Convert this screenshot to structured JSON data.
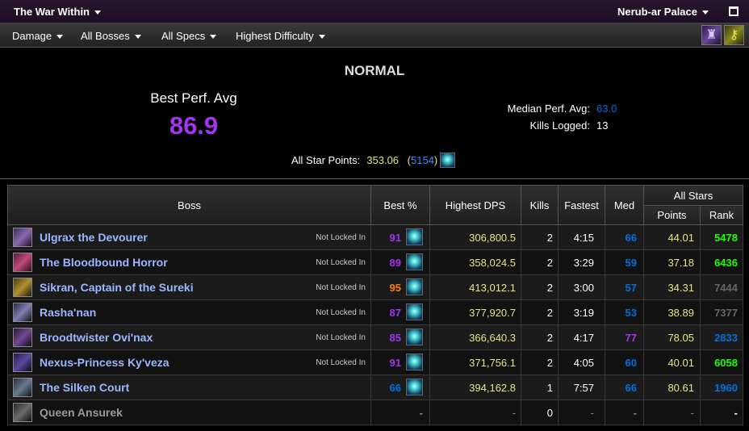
{
  "topbar": {
    "expansion": "The War Within",
    "raid": "Nerub-ar Palace"
  },
  "filters": {
    "metric": "Damage",
    "bosses": "All Bosses",
    "specs": "All Specs",
    "difficulty": "Highest Difficulty"
  },
  "summary": {
    "difficulty": "NORMAL",
    "best_perf_label": "Best Perf. Avg",
    "best_perf_value": "86.9",
    "median_label": "Median Perf. Avg:",
    "median_value": "63.0",
    "kills_label": "Kills Logged:",
    "kills_value": "13",
    "star_points_label": "All Star Points:",
    "star_points_value": "353.06",
    "star_points_rank": "5154"
  },
  "table": {
    "headers": {
      "boss": "Boss",
      "best": "Best %",
      "dps": "Highest DPS",
      "kills": "Kills",
      "fastest": "Fastest",
      "med": "Med",
      "all_stars": "All Stars",
      "points": "Points",
      "rank": "Rank"
    },
    "colors": {
      "legendary": "#ff8000",
      "epic": "#a335ee",
      "rare": "#0070dd",
      "uncommon": "#1eff00",
      "common": "#666666",
      "dps": "#e6e680"
    },
    "rows": [
      {
        "name": "Ulgrax the Devourer",
        "lock": "Not Locked In",
        "best": "91",
        "best_color": "#a335ee",
        "dps": "306,800.5",
        "kills": "2",
        "fastest": "4:15",
        "med": "66",
        "med_color": "#0070dd",
        "points": "44.01",
        "rank": "5478",
        "rank_color": "#1eff00",
        "icon": "boss-ulgrax-icon"
      },
      {
        "name": "The Bloodbound Horror",
        "lock": "Not Locked In",
        "best": "89",
        "best_color": "#a335ee",
        "dps": "358,024.5",
        "kills": "2",
        "fastest": "3:29",
        "med": "59",
        "med_color": "#0070dd",
        "points": "37.18",
        "rank": "6436",
        "rank_color": "#1eff00",
        "icon": "boss-bloodbound-icon"
      },
      {
        "name": "Sikran, Captain of the Sureki",
        "lock": "Not Locked In",
        "best": "95",
        "best_color": "#ff8000",
        "dps": "413,012.1",
        "kills": "2",
        "fastest": "3:00",
        "med": "57",
        "med_color": "#0070dd",
        "points": "34.31",
        "rank": "7444",
        "rank_color": "#666666",
        "icon": "boss-sikran-icon"
      },
      {
        "name": "Rasha'nan",
        "lock": "Not Locked In",
        "best": "87",
        "best_color": "#a335ee",
        "dps": "377,920.7",
        "kills": "2",
        "fastest": "3:19",
        "med": "53",
        "med_color": "#0070dd",
        "points": "38.89",
        "rank": "7377",
        "rank_color": "#666666",
        "icon": "boss-rashanan-icon"
      },
      {
        "name": "Broodtwister Ovi'nax",
        "lock": "Not Locked In",
        "best": "85",
        "best_color": "#a335ee",
        "dps": "366,640.3",
        "kills": "2",
        "fastest": "4:17",
        "med": "77",
        "med_color": "#a335ee",
        "points": "78.05",
        "rank": "2833",
        "rank_color": "#0070dd",
        "icon": "boss-ovinax-icon"
      },
      {
        "name": "Nexus-Princess Ky'veza",
        "lock": "Not Locked In",
        "best": "91",
        "best_color": "#a335ee",
        "dps": "371,756.1",
        "kills": "2",
        "fastest": "4:05",
        "med": "60",
        "med_color": "#0070dd",
        "points": "40.01",
        "rank": "6058",
        "rank_color": "#1eff00",
        "icon": "boss-kyveza-icon"
      },
      {
        "name": "The Silken Court",
        "lock": "",
        "best": "66",
        "best_color": "#0070dd",
        "dps": "394,162.8",
        "kills": "1",
        "fastest": "7:57",
        "med": "66",
        "med_color": "#0070dd",
        "points": "80.61",
        "rank": "1960",
        "rank_color": "#0070dd",
        "icon": "boss-silken-court-icon"
      },
      {
        "name": "Queen Ansurek",
        "lock": "",
        "best": "-",
        "best_color": "#888888",
        "dps": "-",
        "kills": "0",
        "fastest": "-",
        "med": "-",
        "med_color": "#888888",
        "points": "-",
        "rank": "-",
        "rank_color": "#ffffff",
        "icon": "boss-ansurek-icon"
      }
    ]
  }
}
